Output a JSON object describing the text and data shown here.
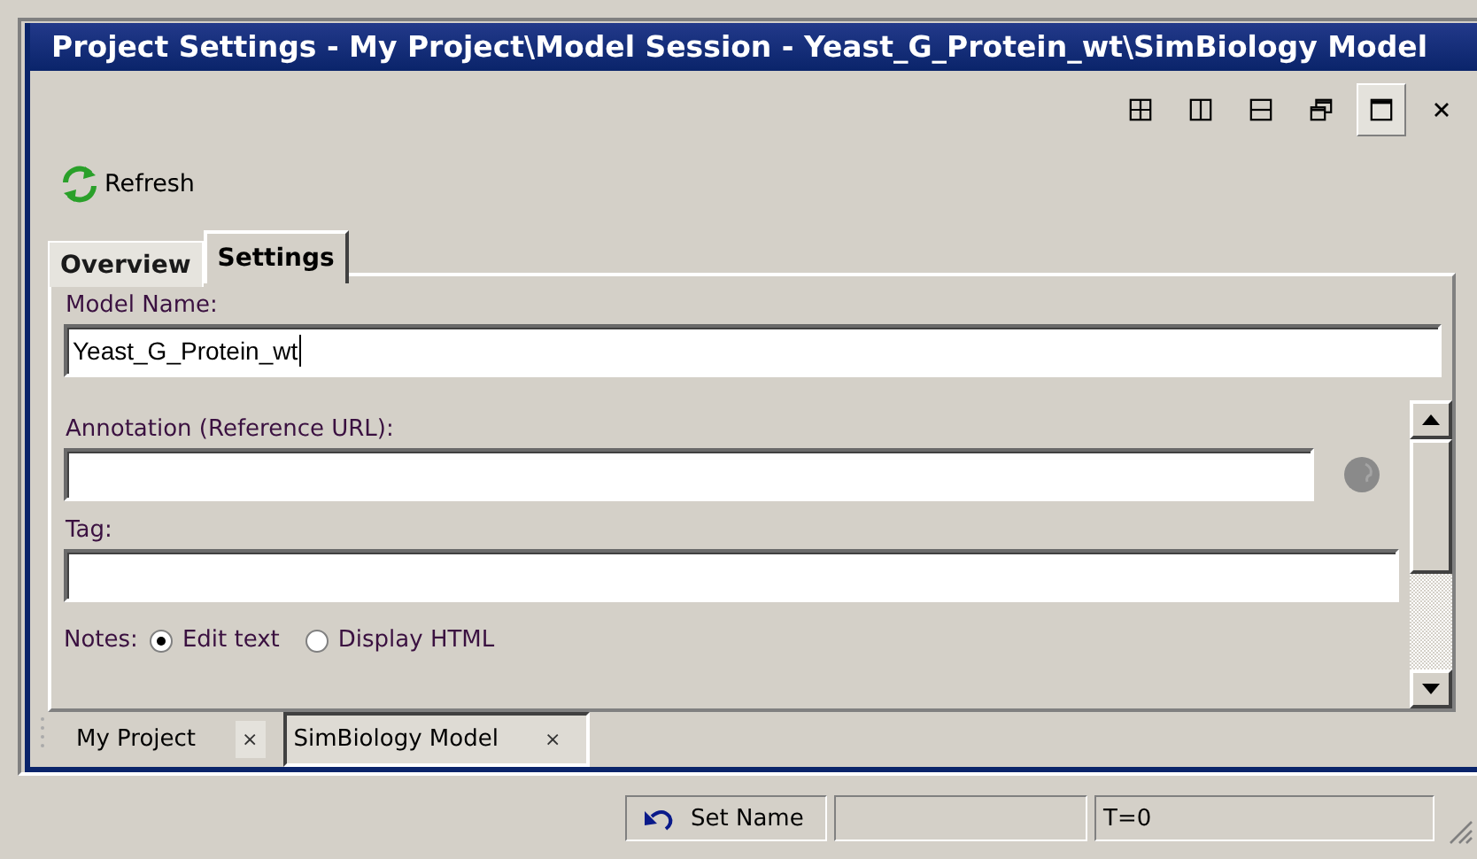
{
  "window": {
    "title": "Project Settings - My Project\\Model Session - Yeast_G_Protein_wt\\SimBiology Model"
  },
  "layout_buttons": [
    {
      "kind": "grid",
      "selected": false
    },
    {
      "kind": "columns",
      "selected": false
    },
    {
      "kind": "rows",
      "selected": false
    },
    {
      "kind": "restore",
      "selected": false
    },
    {
      "kind": "maximize",
      "selected": true
    },
    {
      "kind": "close",
      "selected": false
    }
  ],
  "toolbar": {
    "refresh": "Refresh"
  },
  "tabs": [
    {
      "label": "Overview",
      "selected": false
    },
    {
      "label": "Settings",
      "selected": true
    }
  ],
  "model_name": {
    "label": "Model Name:",
    "value": "Yeast_G_Protein_wt"
  },
  "annotation": {
    "label": "Annotation (Reference URL):"
  },
  "tag": {
    "label": "Tag:"
  },
  "notes": {
    "label": "Notes:",
    "options": [
      {
        "label": "Edit text",
        "selected": true
      },
      {
        "label": "Display HTML",
        "selected": false
      }
    ]
  },
  "document_tabs": [
    {
      "label": "My Project",
      "close": "×",
      "selected": false
    },
    {
      "label": "SimBiology Model",
      "close": "×",
      "selected": true
    }
  ],
  "status_bar": {
    "action": "Set Name",
    "time": "T=0"
  }
}
